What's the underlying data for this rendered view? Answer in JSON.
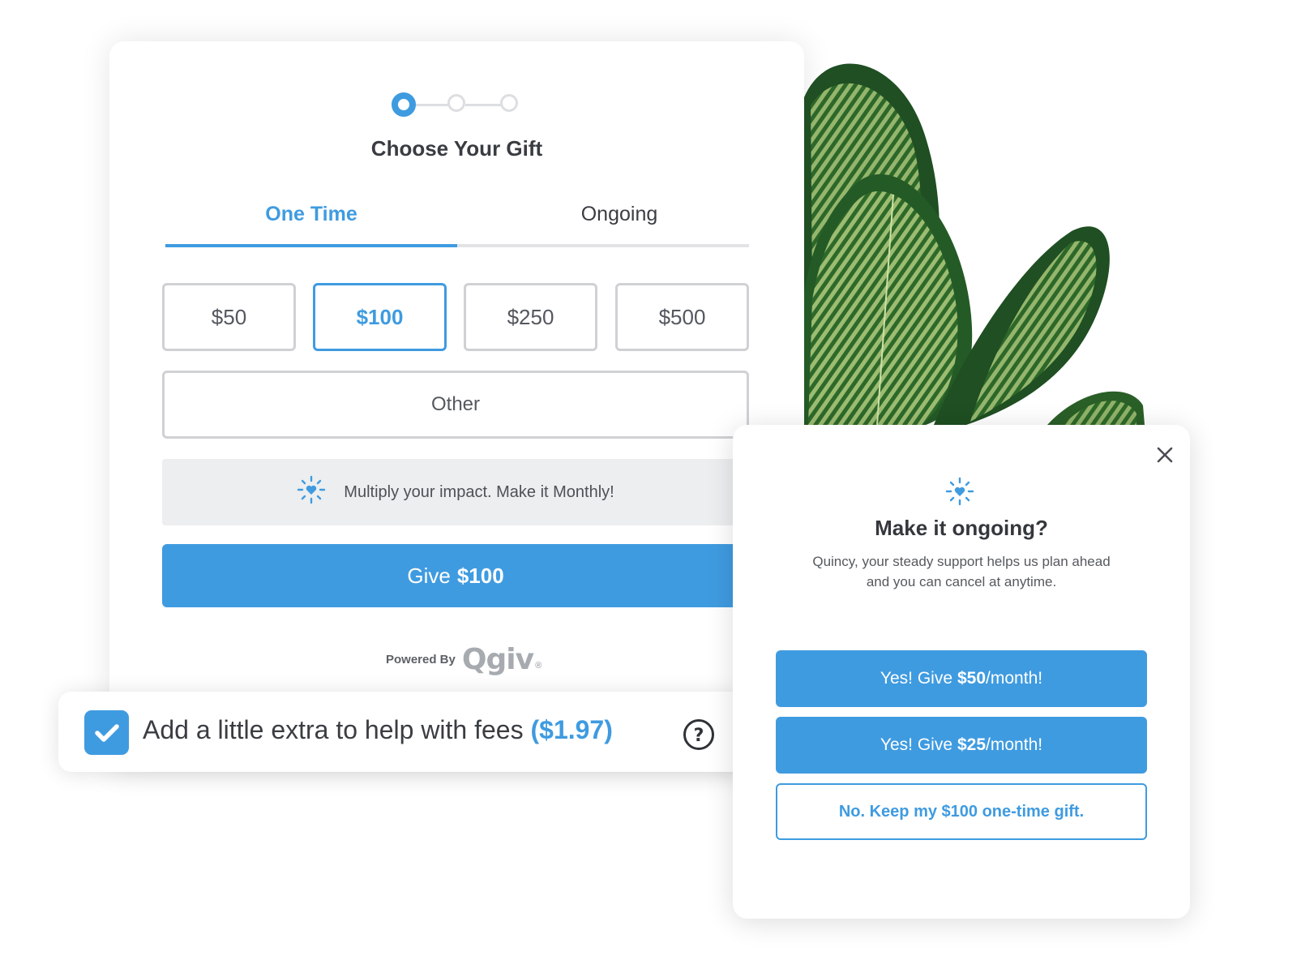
{
  "stepper": {
    "total_steps": 3,
    "current_step": 1
  },
  "main": {
    "title": "Choose Your Gift",
    "tabs": [
      {
        "label": "One Time",
        "active": true
      },
      {
        "label": "Ongoing",
        "active": false
      }
    ],
    "amounts": [
      {
        "label": "$50",
        "selected": false
      },
      {
        "label": "$100",
        "selected": true
      },
      {
        "label": "$250",
        "selected": false
      },
      {
        "label": "$500",
        "selected": false
      }
    ],
    "other_label": "Other",
    "promo_text": "Multiply your impact. Make it Monthly!",
    "give_button": {
      "prefix": "Give",
      "amount": "$100"
    },
    "powered_by": "Powered By",
    "brand": "Qgiv",
    "brand_mark": "®"
  },
  "fee_bar": {
    "checked": true,
    "text": "Add a little extra to help with fees",
    "amount": "($1.97)"
  },
  "popup": {
    "title": "Make it ongoing?",
    "body_line1": "Quincy, your steady support helps us plan ahead",
    "body_line2": "and you can cancel at anytime.",
    "buttons": [
      {
        "prefix": "Yes! Give",
        "amount": "$50",
        "suffix": "/month!"
      },
      {
        "prefix": "Yes! Give",
        "amount": "$25",
        "suffix": "/month!"
      }
    ],
    "decline_label": "No. Keep my $100 one-time gift."
  },
  "colors": {
    "accent": "#3f9be0",
    "text_dark": "#3a3d42",
    "border_gray": "#cfd1d4",
    "promo_bg": "#eceef0"
  }
}
